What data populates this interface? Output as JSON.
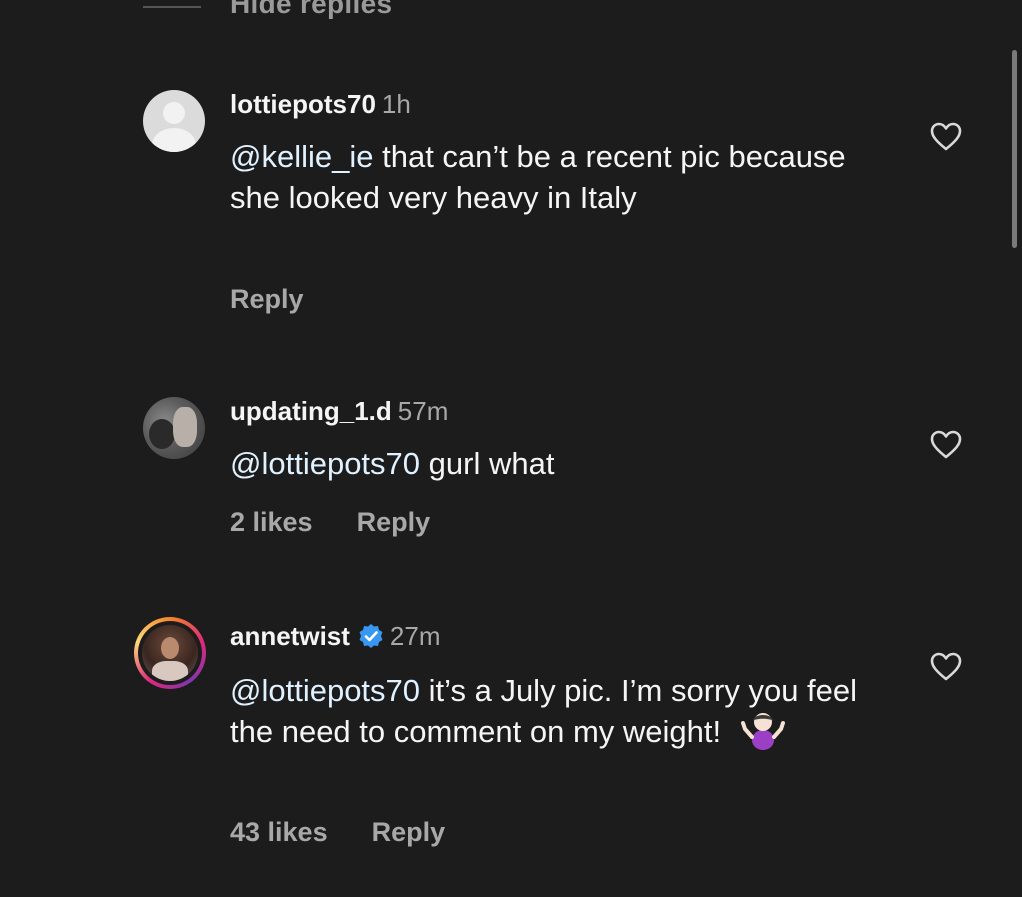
{
  "header": {
    "hide_replies_label": "Hide replies"
  },
  "comments": [
    {
      "username": "lottiepots70",
      "time": "1h",
      "verified": false,
      "mention": "@kellie_ie",
      "text": " that can’t be a recent pic because she looked very heavy in Italy",
      "likes": "",
      "reply_label": "Reply",
      "avatar": "default-profile-icon"
    },
    {
      "username": "updating_1.d",
      "time": "57m",
      "verified": false,
      "mention": "@lottiepots70",
      "text": " gurl what",
      "likes": "2 likes",
      "reply_label": "Reply",
      "avatar": "photo"
    },
    {
      "username": "annetwist",
      "time": "27m",
      "verified": true,
      "mention": "@lottiepots70",
      "text": " it’s a July pic. I’m sorry you feel the need to comment on my weight!",
      "emoji": "🤷🏻‍♀️",
      "likes": "43 likes",
      "reply_label": "Reply",
      "avatar": "photo-with-story-ring"
    }
  ],
  "colors": {
    "background": "#1c1c1c",
    "text": "#f5f5f5",
    "secondary_text": "#a8a8a8",
    "verified_badge": "#3897f0"
  }
}
